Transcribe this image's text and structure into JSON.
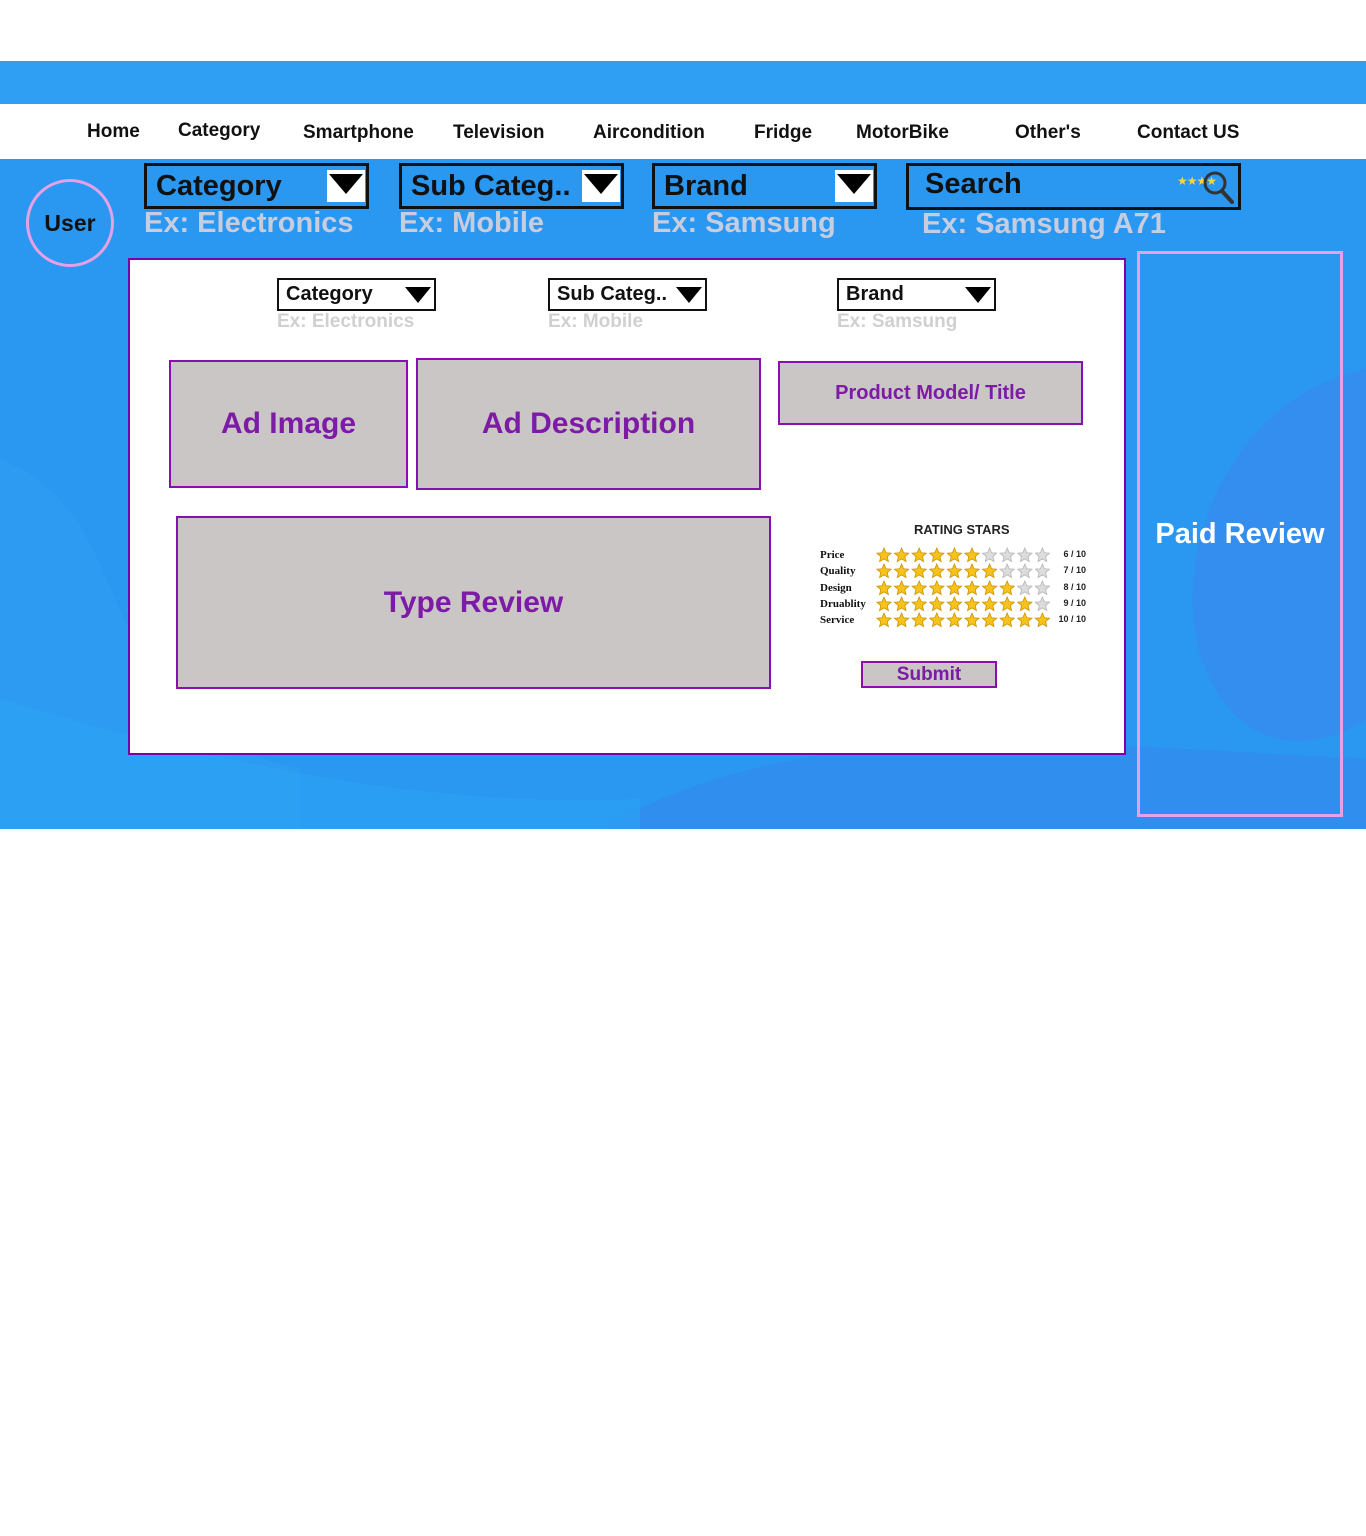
{
  "nav": {
    "items": [
      {
        "label": "Home"
      },
      {
        "label": "Category"
      },
      {
        "label": "Smartphone"
      },
      {
        "label": "Television"
      },
      {
        "label": "Aircondition"
      },
      {
        "label": "Fridge"
      },
      {
        "label": "MotorBike"
      },
      {
        "label": "Other's"
      },
      {
        "label": "Contact US"
      }
    ]
  },
  "user": {
    "label": "User"
  },
  "filters": {
    "category": {
      "label": "Category",
      "hint": "Ex: Electronics"
    },
    "subcategory": {
      "label": "Sub Categ..",
      "hint": "Ex: Mobile"
    },
    "brand": {
      "label": "Brand",
      "hint": "Ex: Samsung"
    },
    "search": {
      "label": "Search",
      "hint": "Ex: Samsung A71"
    }
  },
  "form": {
    "category": {
      "label": "Category",
      "hint": "Ex: Electronics"
    },
    "subcategory": {
      "label": "Sub Categ..",
      "hint": "Ex: Mobile"
    },
    "brand": {
      "label": "Brand",
      "hint": "Ex: Samsung"
    },
    "ad_image": "Ad Image",
    "ad_description": "Ad Description",
    "product_title": "Product Model/ Title",
    "type_review": "Type Review",
    "submit": "Submit"
  },
  "rating": {
    "title": "RATING STARS",
    "max": 10,
    "rows": [
      {
        "name": "Price",
        "value": 6,
        "score": "6 / 10"
      },
      {
        "name": "Quality",
        "value": 7,
        "score": "7 / 10"
      },
      {
        "name": "Design",
        "value": 8,
        "score": "8 / 10"
      },
      {
        "name": "Druablity",
        "value": 9,
        "score": "9 / 10"
      },
      {
        "name": "Service",
        "value": 10,
        "score": "10 / 10"
      }
    ]
  },
  "paid_review": {
    "label": "Paid Review"
  },
  "colors": {
    "hero_blue": "#2a97f1",
    "accent_purple": "#7d1aa6",
    "box_gray": "#cbc6c6",
    "star_filled": "#f7c21a",
    "star_empty": "#dcdcdc"
  }
}
